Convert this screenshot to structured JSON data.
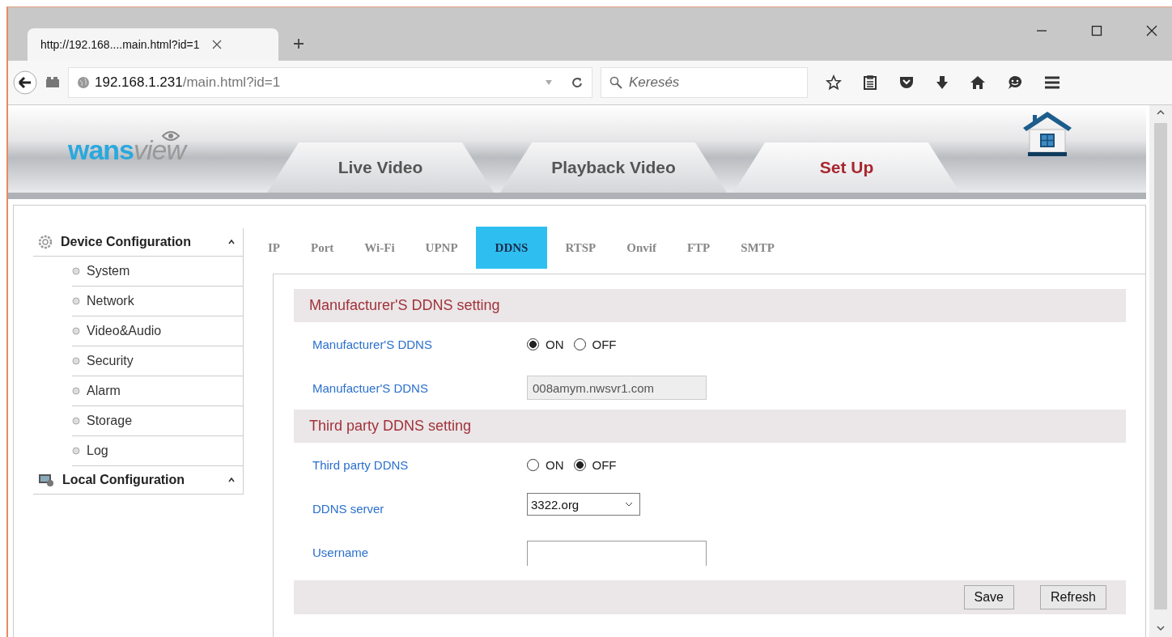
{
  "browser": {
    "tab_title": "http://192.168....main.html?id=1",
    "address_host": "192.168.1.231",
    "address_path": "/main.html?id=1",
    "search_placeholder": "Keresés"
  },
  "header": {
    "logo": {
      "part1": "wans",
      "part2": "view"
    },
    "nav_tabs": [
      {
        "label": "Live Video",
        "selected": false
      },
      {
        "label": "Playback Video",
        "selected": false
      },
      {
        "label": "Set Up",
        "selected": true
      }
    ]
  },
  "sidebar": [
    {
      "title": "Device Configuration",
      "children": [
        "System",
        "Network",
        "Video&Audio",
        "Security",
        "Alarm",
        "Storage",
        "Log"
      ]
    },
    {
      "title": "Local Configuration"
    }
  ],
  "subtabs": [
    {
      "label": "IP",
      "selected": false
    },
    {
      "label": "Port",
      "selected": false
    },
    {
      "label": "Wi-Fi",
      "selected": false
    },
    {
      "label": "UPNP",
      "selected": false
    },
    {
      "label": "DDNS",
      "selected": true
    },
    {
      "label": "RTSP",
      "selected": false
    },
    {
      "label": "Onvif",
      "selected": false
    },
    {
      "label": "FTP",
      "selected": false
    },
    {
      "label": "SMTP",
      "selected": false
    }
  ],
  "sections": [
    {
      "title": "Manufacturer'S DDNS setting",
      "rows": [
        {
          "kind": "radio",
          "label": "Manufacturer'S DDNS",
          "options": [
            {
              "label": "ON",
              "selected": true
            },
            {
              "label": "OFF",
              "selected": false
            }
          ]
        },
        {
          "kind": "text",
          "label": "Manufactuer'S DDNS",
          "value": "008amym.nwsvr1.com",
          "disabled": true
        }
      ]
    },
    {
      "title": "Third party DDNS setting",
      "rows": [
        {
          "kind": "radio",
          "label": "Third party DDNS",
          "options": [
            {
              "label": "ON",
              "selected": false
            },
            {
              "label": "OFF",
              "selected": true
            }
          ]
        },
        {
          "kind": "select",
          "label": "DDNS server",
          "value": "3322.org"
        },
        {
          "kind": "text",
          "label": "Username",
          "value": "",
          "disabled": false
        }
      ]
    }
  ],
  "buttons": [
    "Save",
    "Refresh"
  ]
}
